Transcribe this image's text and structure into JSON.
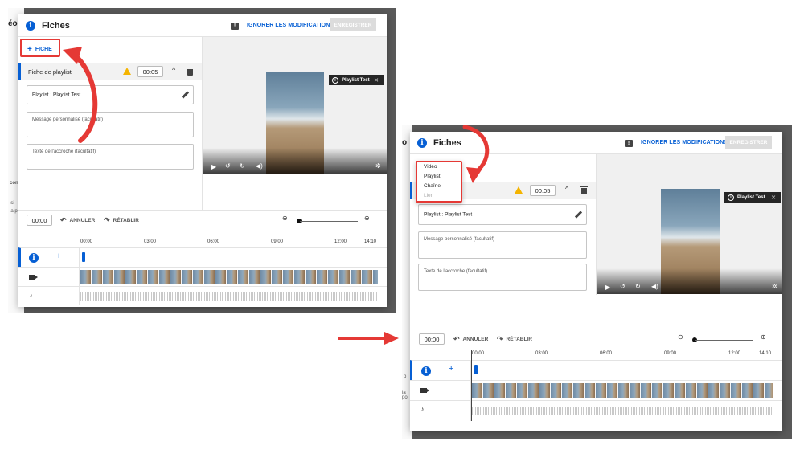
{
  "colors": {
    "accent": "#065fd4",
    "annotation": "#e53935",
    "warning": "#f4b400"
  },
  "left_panel": {
    "background_text": [
      "éo",
      "con",
      "isi",
      "la po"
    ],
    "dialog": {
      "title": "Fiches",
      "discard_label": "IGNORER LES MODIFICATIONS",
      "save_label": "ENREGISTRER",
      "add_card_label": "FICHE",
      "card_row": {
        "label": "Fiche de playlist",
        "time": "00:05"
      },
      "playlist_field": "Playlist : Playlist Test",
      "message_placeholder": "Message personnalisé (facultatif)",
      "teaser_placeholder": "Texte de l'accroche (facultatif)",
      "video_badge": "Playlist Test",
      "timeline": {
        "current_time": "00:00",
        "undo_label": "ANNULER",
        "redo_label": "RÉTABLIR",
        "ticks": [
          "00:00",
          "03:00",
          "06:00",
          "09:00",
          "12:00",
          "14:10"
        ]
      }
    }
  },
  "right_panel": {
    "background_text": [
      "o",
      "p",
      "la po"
    ],
    "dialog": {
      "title": "Fiches",
      "discard_label": "IGNORER LES MODIFICATIONS",
      "save_label": "ENREGISTRER",
      "menu_items": [
        "Vidéo",
        "Playlist",
        "Chaîne",
        "Lien"
      ],
      "card_row": {
        "time": "00:05"
      },
      "playlist_field": "Playlist : Playlist Test",
      "message_placeholder": "Message personnalisé (facultatif)",
      "teaser_placeholder": "Texte de l'accroche (facultatif)",
      "video_badge": "Playlist Test",
      "timeline": {
        "current_time": "00:00",
        "undo_label": "ANNULER",
        "redo_label": "RÉTABLIR",
        "ticks": [
          "00:00",
          "03:00",
          "06:00",
          "09:00",
          "12:00",
          "14:10"
        ]
      }
    }
  },
  "icons": [
    "info-icon",
    "feedback-icon",
    "warning-icon",
    "chevron-up-icon",
    "trash-icon",
    "pencil-icon",
    "play-icon",
    "replay-icon",
    "forward-icon",
    "volume-icon",
    "settings-icon",
    "undo-icon",
    "redo-icon",
    "zoom-out-icon",
    "zoom-in-icon",
    "camera-icon",
    "music-note-icon",
    "plus-icon",
    "red-arrow"
  ]
}
